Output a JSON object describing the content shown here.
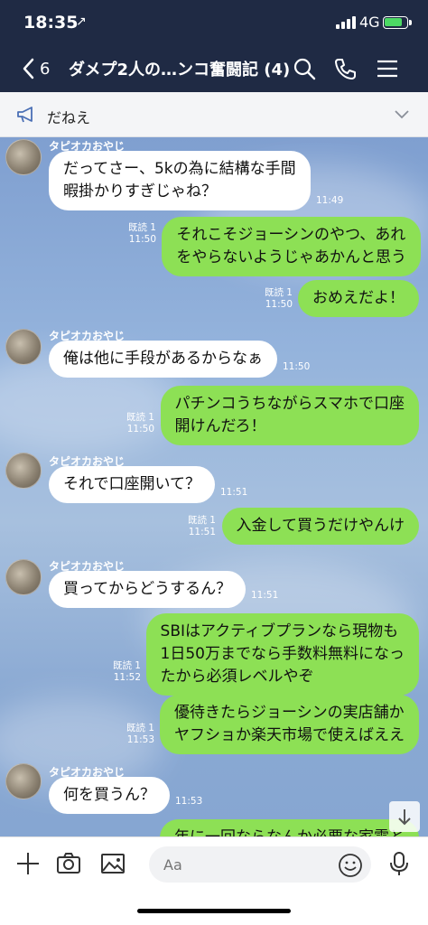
{
  "status": {
    "time": "18:35",
    "network": "4G",
    "location_arrow": "↗",
    "battery_fraction": 0.85,
    "battery_color": "#4cd964"
  },
  "header": {
    "back_count": "6",
    "title": "ダメプ2人の…ンコ奮闘記 (4)",
    "icons": [
      "chevron-left-icon",
      "search-icon",
      "phone-icon",
      "menu-icon"
    ]
  },
  "announcement": {
    "text": "だねえ",
    "icons": [
      "megaphone-icon",
      "chevron-down-icon"
    ]
  },
  "chat": {
    "messages": [
      {
        "side": "in",
        "sender": "タピオカおやじ",
        "lines": [
          "だってさー、5kの為に結構な手間",
          "暇掛かりすぎじゃね？"
        ],
        "time": "11:49"
      },
      {
        "side": "out",
        "lines": [
          "それこそジョーシンのやつ、あれ",
          "をやらないようじゃあかんと思う"
        ],
        "read": "既読 1",
        "time": "11:50"
      },
      {
        "side": "out",
        "lines": [
          "おめえだよ！"
        ],
        "read": "既読 1",
        "time": "11:50"
      },
      {
        "side": "in",
        "sender": "タピオカおやじ",
        "lines": [
          "俺は他に手段があるからなぁ"
        ],
        "time": "11:50"
      },
      {
        "side": "out",
        "lines": [
          "パチンコうちながらスマホで口座",
          "開けんだろ！"
        ],
        "read": "既読 1",
        "time": "11:50"
      },
      {
        "side": "in",
        "sender": "タピオカおやじ",
        "lines": [
          "それで口座開いて？"
        ],
        "time": "11:51"
      },
      {
        "side": "out",
        "lines": [
          "入金して買うだけやんけ"
        ],
        "read": "既読 1",
        "time": "11:51"
      },
      {
        "side": "in",
        "sender": "タピオカおやじ",
        "lines": [
          "買ってからどうするん？"
        ],
        "time": "11:51"
      },
      {
        "side": "out",
        "lines": [
          "SBIはアクティブプランなら現物も",
          "1日50万までなら手数料無料になっ",
          "たから必須レベルやぞ"
        ],
        "read": "既読 1",
        "time": "11:52"
      },
      {
        "side": "out",
        "lines": [
          "優待きたらジョーシンの実店舗か",
          "ヤフショか楽天市場で使えばええ"
        ],
        "read": "既読 1",
        "time": "11:53"
      },
      {
        "side": "in",
        "sender": "タピオカおやじ",
        "lines": [
          "何を買うん？"
        ],
        "time": "11:53"
      },
      {
        "side": "out",
        "lines": [
          "年に一回ならなんか必要な家電と"
        ]
      }
    ]
  },
  "input": {
    "placeholder": "Aa",
    "icons": [
      "plus-icon",
      "camera-icon",
      "image-icon",
      "emoji-icon",
      "microphone-icon"
    ]
  },
  "colors": {
    "header_bg": "#1f2a44",
    "bubble_out": "#8de055",
    "bubble_in": "#ffffff",
    "chat_bg": "#8fb0d8"
  }
}
